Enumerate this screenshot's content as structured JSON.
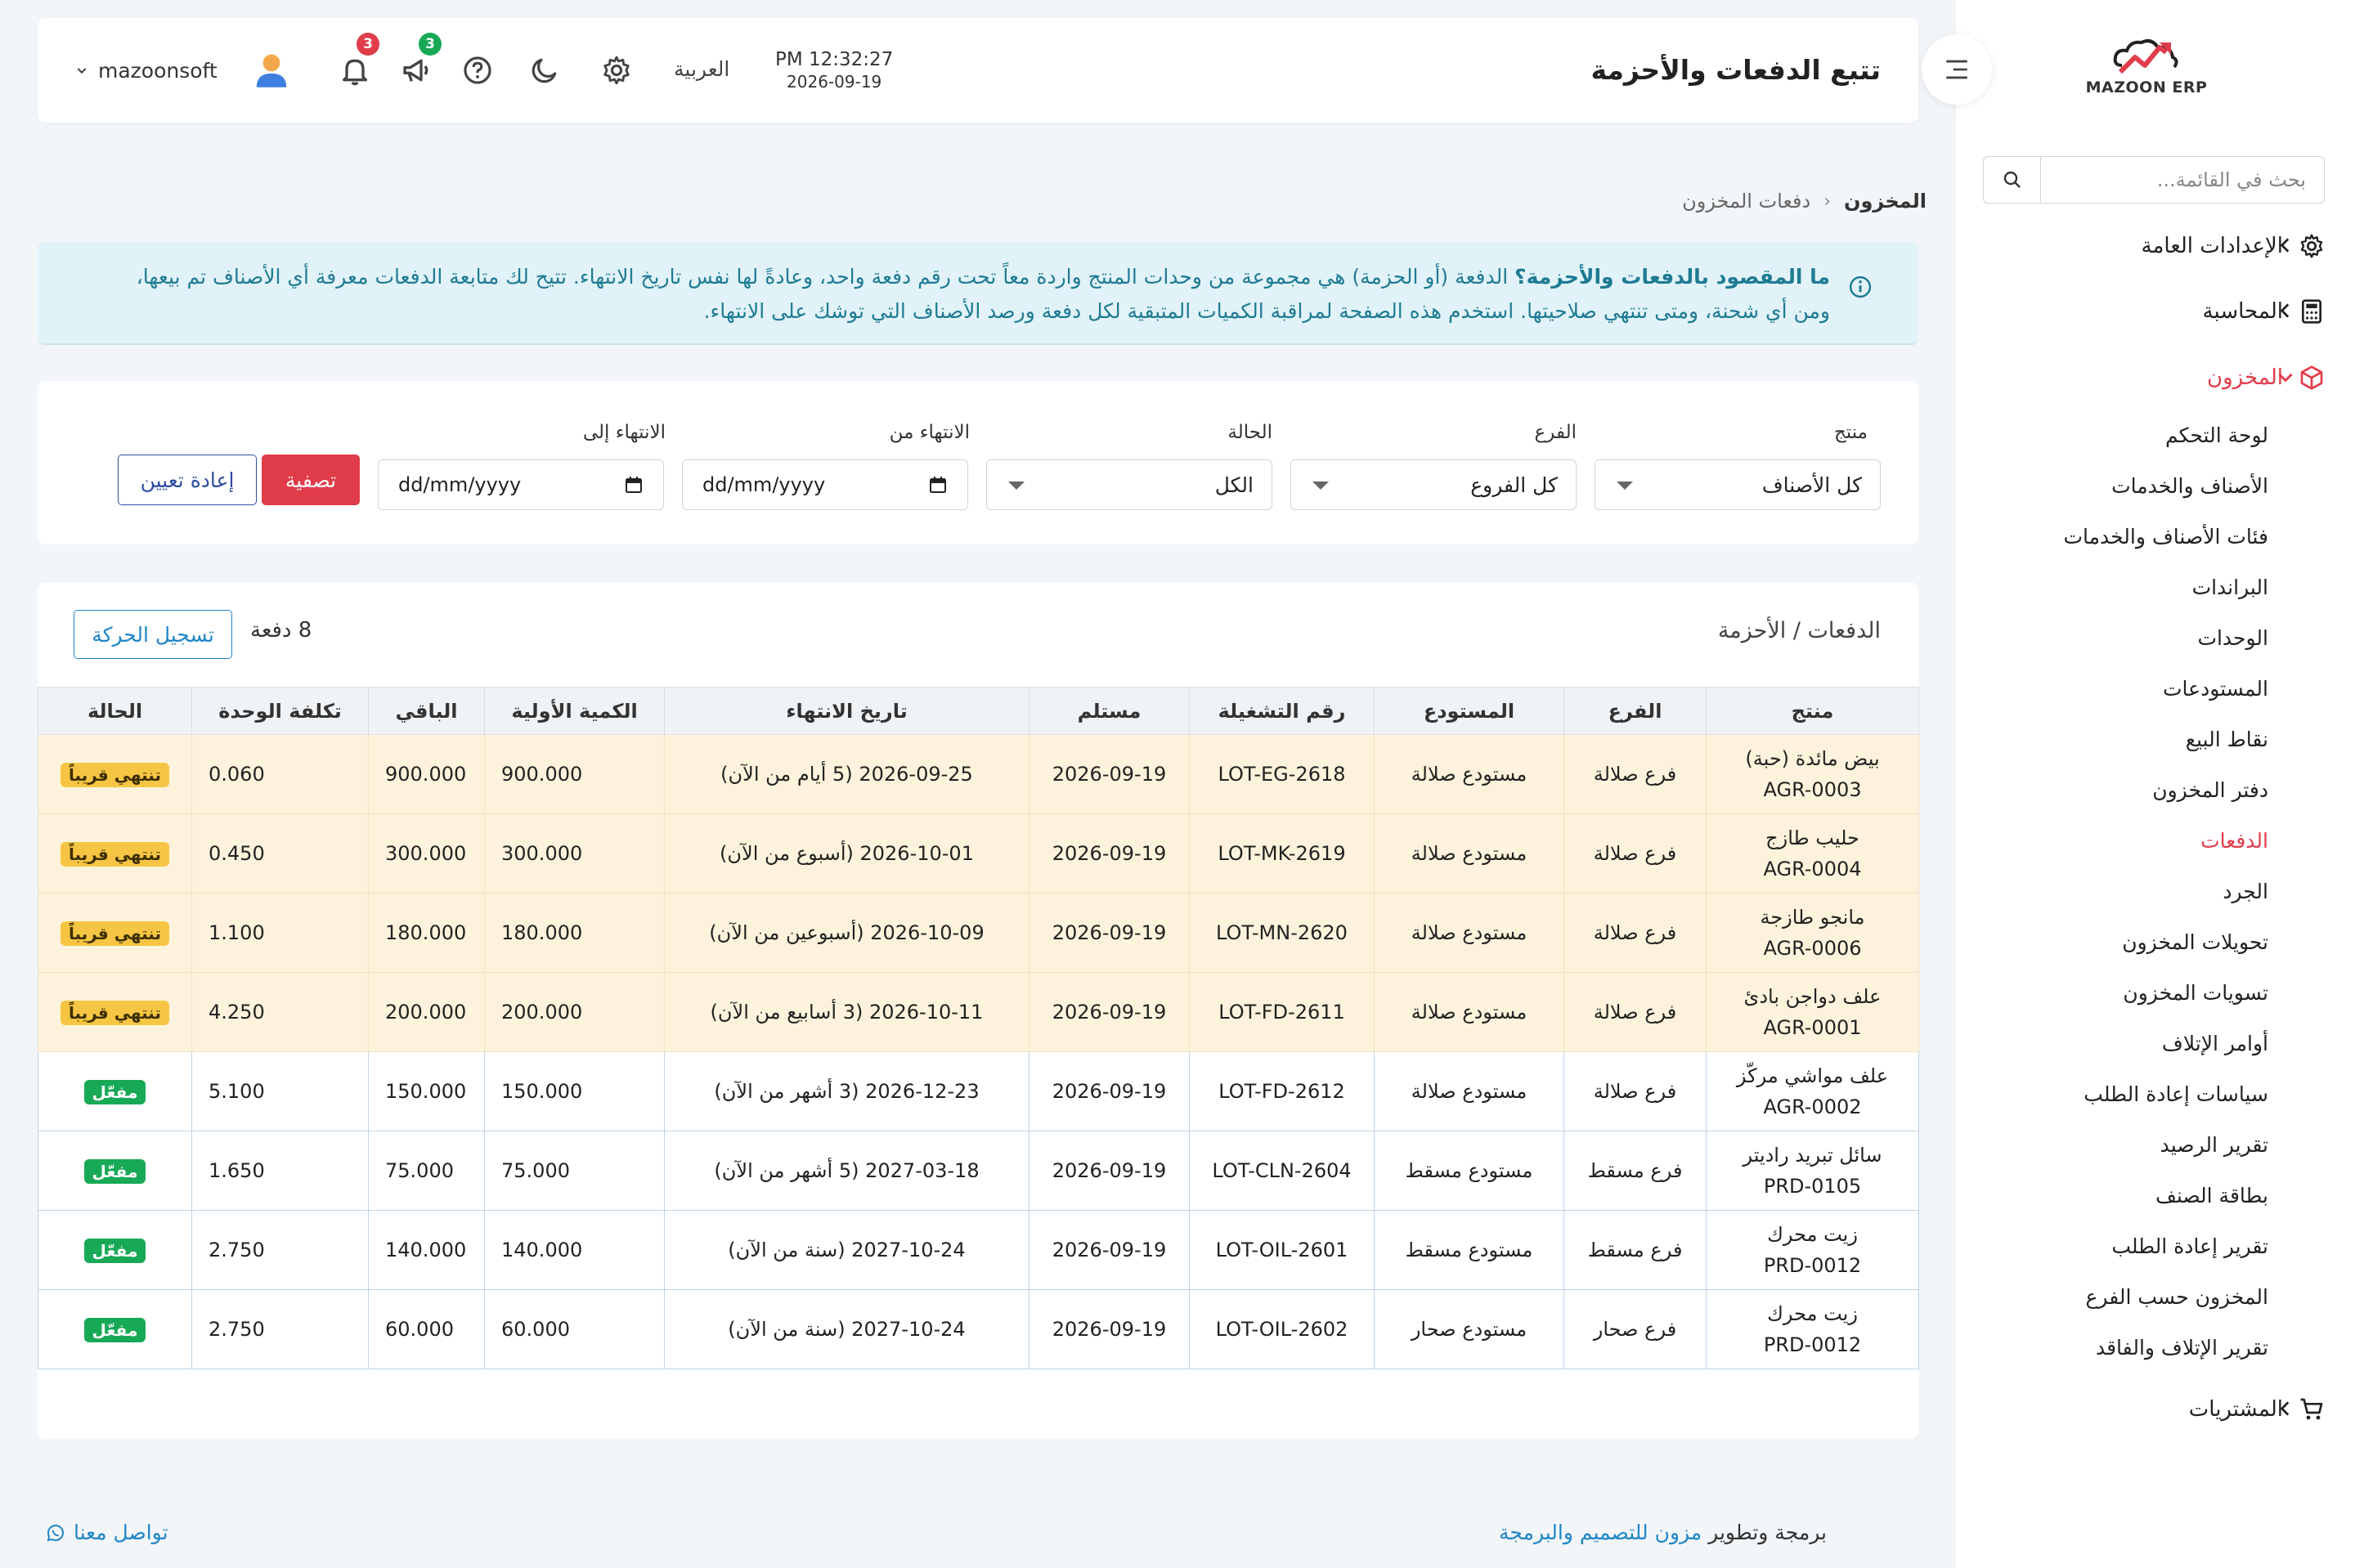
{
  "sidebar": {
    "logo_text": "MAZOON ERP",
    "search_placeholder": "بحث في القائمة...",
    "groups": [
      {
        "label": "الإعدادات العامة",
        "icon": "gear-icon"
      },
      {
        "label": "المحاسبة",
        "icon": "calculator-icon"
      },
      {
        "label": "المخزون",
        "icon": "box-icon"
      },
      {
        "label": "المشتريات",
        "icon": "cart-icon"
      }
    ],
    "inventory_items": [
      "لوحة التحكم",
      "الأصناف والخدمات",
      "فئات الأصناف والخدمات",
      "البراندات",
      "الوحدات",
      "المستودعات",
      "نقاط البيع",
      "دفتر المخزون",
      "الدفعات",
      "الجرد",
      "تحويلات المخزون",
      "تسويات المخزون",
      "أوامر الإتلاف",
      "سياسات إعادة الطلب",
      "تقرير الرصيد",
      "بطاقة الصنف",
      "تقرير إعادة الطلب",
      "المخزون حسب الفرع",
      "تقرير الإتلاف والفاقد"
    ]
  },
  "header": {
    "title": "تتبع الدفعات والأحزمة",
    "time": "PM 12:32:27",
    "date": "2026-09-19",
    "language": "العربية",
    "notifications_count": "3",
    "announcements_count": "3",
    "username": "mazoonsoft"
  },
  "breadcrumb": {
    "root": "المخزون",
    "current": "دفعات المخزون"
  },
  "info": {
    "question": "ما المقصود بالدفعات والأحزمة؟",
    "body": "الدفعة (أو الحزمة) هي مجموعة من وحدات المنتج واردة معاً تحت رقم دفعة واحد، وعادةً لها نفس تاريخ الانتهاء. تتيح لك متابعة الدفعات معرفة أي الأصناف تم بيعها، ومن أي شحنة، ومتى تنتهي صلاحيتها. استخدم هذه الصفحة لمراقبة الكميات المتبقية لكل دفعة ورصد الأصناف التي توشك على الانتهاء."
  },
  "filters": {
    "product_label": "منتج",
    "product_value": "كل الأصناف",
    "branch_label": "الفرع",
    "branch_value": "كل الفروع",
    "status_label": "الحالة",
    "status_value": "الكل",
    "expiry_from_label": "الانتهاء من",
    "expiry_to_label": "الانتهاء إلى",
    "date_placeholder": "dd/mm/yyyy",
    "filter_button": "تصفية",
    "reset_button": "إعادة تعيين"
  },
  "table": {
    "title": "الدفعات / الأحزمة",
    "count": "8 دفعة",
    "record_button": "تسجيل الحركة",
    "columns": [
      "منتج",
      "الفرع",
      "المستودع",
      "رقم التشغيلة",
      "مستلم",
      "تاريخ الانتهاء",
      "الكمية الأولية",
      "الباقي",
      "تكلفة الوحدة",
      "الحالة"
    ],
    "rows": [
      {
        "name": "بيض مائدة (حبة)",
        "code": "AGR-0003",
        "branch": "فرع صلالة",
        "warehouse": "مستودع صلالة",
        "lot": "LOT-EG-2618",
        "received": "2026-09-19",
        "expiry": "2026-09-25 (5 أيام من الآن)",
        "initial": "900.000",
        "remaining": "900.000",
        "cost": "0.060",
        "status": "تنتهي قريباً",
        "status_type": "soon"
      },
      {
        "name": "حليب طازج",
        "code": "AGR-0004",
        "branch": "فرع صلالة",
        "warehouse": "مستودع صلالة",
        "lot": "LOT-MK-2619",
        "received": "2026-09-19",
        "expiry": "2026-10-01 (أسبوع من الآن)",
        "initial": "300.000",
        "remaining": "300.000",
        "cost": "0.450",
        "status": "تنتهي قريباً",
        "status_type": "soon"
      },
      {
        "name": "مانجو طازجة",
        "code": "AGR-0006",
        "branch": "فرع صلالة",
        "warehouse": "مستودع صلالة",
        "lot": "LOT-MN-2620",
        "received": "2026-09-19",
        "expiry": "2026-10-09 (أسبوعين من الآن)",
        "initial": "180.000",
        "remaining": "180.000",
        "cost": "1.100",
        "status": "تنتهي قريباً",
        "status_type": "soon"
      },
      {
        "name": "علف دواجن بادئ",
        "code": "AGR-0001",
        "branch": "فرع صلالة",
        "warehouse": "مستودع صلالة",
        "lot": "LOT-FD-2611",
        "received": "2026-09-19",
        "expiry": "2026-10-11 (3 أسابيع من الآن)",
        "initial": "200.000",
        "remaining": "200.000",
        "cost": "4.250",
        "status": "تنتهي قريباً",
        "status_type": "soon"
      },
      {
        "name": "علف مواشي مركّز",
        "code": "AGR-0002",
        "branch": "فرع صلالة",
        "warehouse": "مستودع صلالة",
        "lot": "LOT-FD-2612",
        "received": "2026-09-19",
        "expiry": "2026-12-23 (3 أشهر من الآن)",
        "initial": "150.000",
        "remaining": "150.000",
        "cost": "5.100",
        "status": "مفعّل",
        "status_type": "locked"
      },
      {
        "name": "سائل تبريد راديتر",
        "code": "PRD-0105",
        "branch": "فرع مسقط",
        "warehouse": "مستودع مسقط",
        "lot": "LOT-CLN-2604",
        "received": "2026-09-19",
        "expiry": "2027-03-18 (5 أشهر من الآن)",
        "initial": "75.000",
        "remaining": "75.000",
        "cost": "1.650",
        "status": "مفعّل",
        "status_type": "locked"
      },
      {
        "name": "زيت محرك",
        "code": "PRD-0012",
        "branch": "فرع مسقط",
        "warehouse": "مستودع مسقط",
        "lot": "LOT-OIL-2601",
        "received": "2026-09-19",
        "expiry": "2027-10-24 (سنة من الآن)",
        "initial": "140.000",
        "remaining": "140.000",
        "cost": "2.750",
        "status": "مفعّل",
        "status_type": "locked"
      },
      {
        "name": "زيت محرك",
        "code": "PRD-0012",
        "branch": "فرع صحار",
        "warehouse": "مستودع صحار",
        "lot": "LOT-OIL-2602",
        "received": "2026-09-19",
        "expiry": "2027-10-24 (سنة من الآن)",
        "initial": "60.000",
        "remaining": "60.000",
        "cost": "2.750",
        "status": "مفعّل",
        "status_type": "locked"
      }
    ]
  },
  "footer": {
    "credit_prefix": "برمجة وتطوير",
    "credit_link": "مزون للتصميم والبرمجة",
    "contact": "تواصل معنا"
  },
  "colors": {
    "accent": "#e03c4a",
    "info_bg": "#e1f3f8",
    "info_text": "#1f7b93",
    "warn_row": "#fdf3dc",
    "soon_badge": "#f6c543",
    "locked_badge": "#18a957",
    "link": "#1f86c7"
  }
}
